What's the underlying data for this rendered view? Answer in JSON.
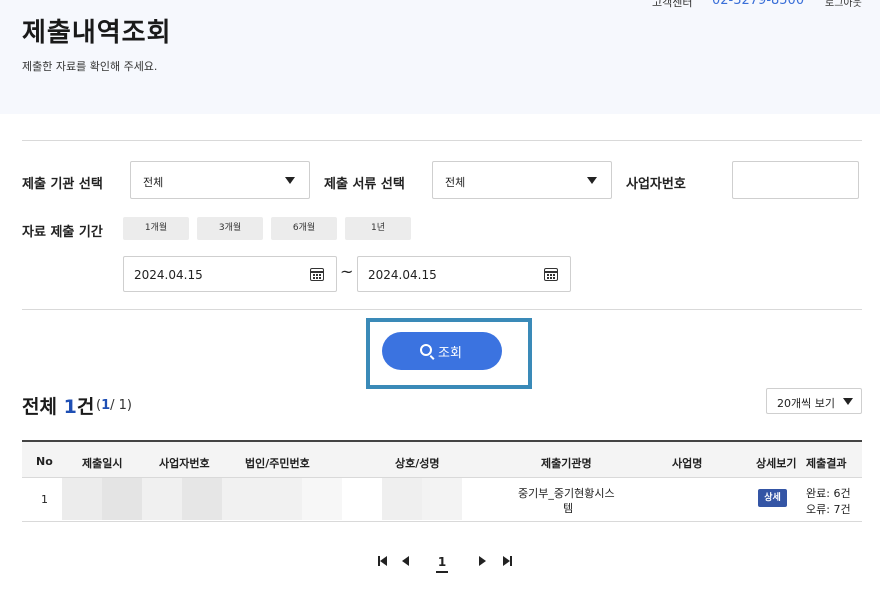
{
  "header": {
    "title": "제출내역조회",
    "subtitle": "제출한 자료를 확인해 주세요.",
    "support_label": "고객센터",
    "support_phone": "02-3279-8500",
    "logout": "로그아웃"
  },
  "filters": {
    "agency_label": "제출 기관 선택",
    "agency_value": "전체",
    "doc_label": "제출 서류 선택",
    "doc_value": "전체",
    "bizno_label": "사업자번호",
    "bizno_value": "",
    "period_label": "자료 제출 기간",
    "period_chips": [
      "1개월",
      "3개월",
      "6개월",
      "1년"
    ],
    "date_from": "2024.04.15",
    "date_to": "2024.04.15",
    "date_separator": "~"
  },
  "search_button": {
    "label": "조회"
  },
  "results": {
    "total_prefix": "전체",
    "total_count": "1",
    "total_suffix": "건",
    "page_open": "(",
    "page_current": "1",
    "page_rest": "/ 1)",
    "per_page": "20개씩 보기"
  },
  "table": {
    "columns": [
      "No",
      "제출일시",
      "사업자번호",
      "법인/주민번호",
      "상호/성명",
      "제출기관명",
      "사업명",
      "상세보기",
      "제출결과"
    ],
    "rows": [
      {
        "no": "1",
        "agency_line1": "중기부_중기현황시스",
        "agency_line2": "템",
        "detail": "상세",
        "result_ok": "완료: 6건",
        "result_err": "오류: 7건"
      }
    ]
  },
  "pagination": {
    "current": "1"
  },
  "colors": {
    "accent": "#3b73e0",
    "highlight_border": "#3a8ab8",
    "badge": "#3455a5",
    "count": "#1f4fb4"
  }
}
